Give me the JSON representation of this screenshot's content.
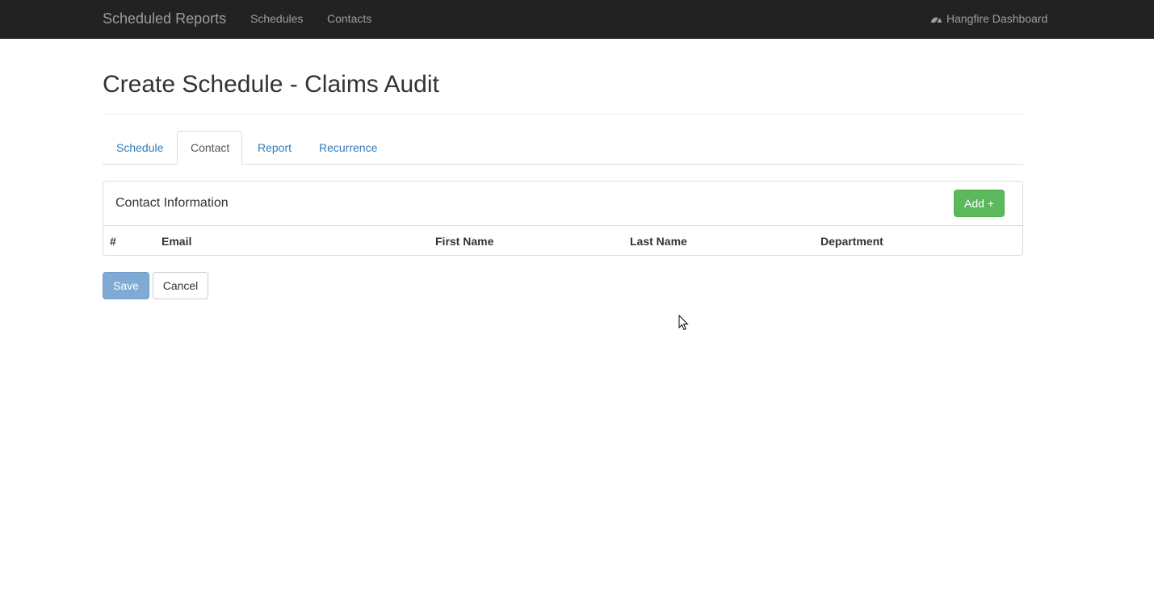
{
  "navbar": {
    "brand": "Scheduled Reports",
    "links": [
      "Schedules",
      "Contacts"
    ],
    "right_link": "Hangfire Dashboard",
    "right_icon": "dashboard-icon"
  },
  "page": {
    "title": "Create Schedule - Claims Audit"
  },
  "tabs": [
    {
      "label": "Schedule",
      "active": false
    },
    {
      "label": "Contact",
      "active": true
    },
    {
      "label": "Report",
      "active": false
    },
    {
      "label": "Recurrence",
      "active": false
    }
  ],
  "panel": {
    "title": "Contact Information",
    "add_label": "Add +",
    "columns": [
      "#",
      "Email",
      "First Name",
      "Last Name",
      "Department"
    ],
    "rows": []
  },
  "actions": {
    "save_label": "Save",
    "cancel_label": "Cancel"
  },
  "colors": {
    "navbar": "#222222",
    "link": "#337ab7",
    "success": "#5cb85c",
    "primary_disabled": "#7faad3"
  }
}
